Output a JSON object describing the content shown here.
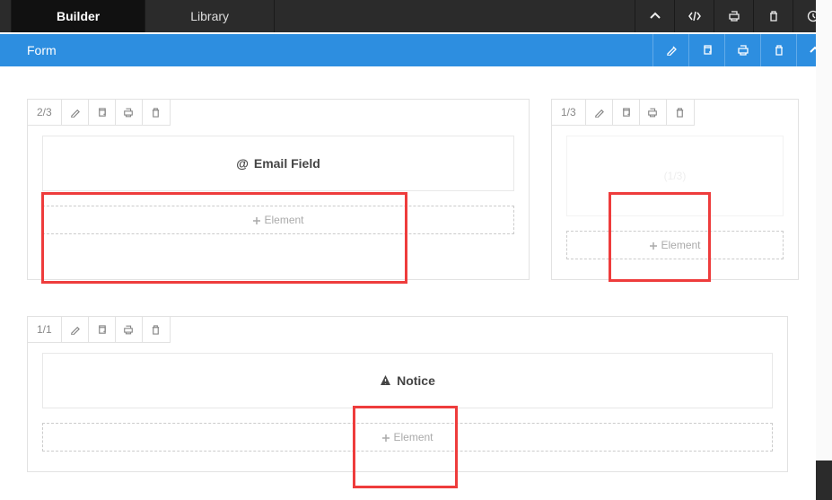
{
  "tabs": {
    "builder": "Builder",
    "library": "Library"
  },
  "section": {
    "title": "Form"
  },
  "fractions": {
    "two_thirds": "2/3",
    "one_third": "1/3",
    "full": "1/1"
  },
  "blocks": {
    "email": "Email Field",
    "faint": "(1/3)",
    "notice": "Notice",
    "add": "Element"
  }
}
